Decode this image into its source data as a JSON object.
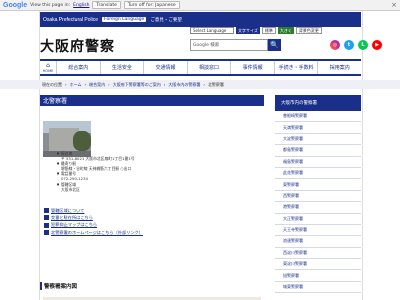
{
  "translate_bar": {
    "brand": "Google",
    "prompt": "View this page in:",
    "language": "English",
    "translate_btn": "Translate",
    "original_btn": "Turn off for: Japanese",
    "close": "×"
  },
  "topband": {
    "site_en": "Osaka Prefectural Police",
    "lang_btn": "Foreign Language",
    "links": "ご意見・ご要望"
  },
  "header": {
    "logo": "大阪府警察",
    "select_language": "Select Language",
    "font_small": "文字サイズ",
    "font_normal": "標準",
    "font_large": "大きく",
    "color_btn": "背景色変更",
    "search_placeholder": "Google 検索",
    "search_btn": "🔍",
    "social": [
      "instagram",
      "twitter",
      "line",
      "youtube"
    ]
  },
  "nav": {
    "home": "HOME",
    "items": [
      "総合案内",
      "生活安全",
      "交通情報",
      "相談窓口",
      "事件情報",
      "手続き・手数料",
      "採用案内"
    ]
  },
  "breadcrumb": [
    "現在の位置",
    "ホーム",
    "総合案内",
    "大阪府下警察署等のご案内",
    "大阪市内の警察署",
    "北警察署"
  ],
  "page": {
    "title": "北警察署",
    "info": {
      "addr_label": "所在地",
      "addr": "〒 531-8021 大阪市北区扇町1丁目1番1号",
      "access_label": "最寄り駅",
      "access": "堺筋線・谷町線 天神橋筋六丁目駅 ○出口",
      "tel_label": "電話番号",
      "tel": "072-290-1234",
      "area_label": "管轄区域",
      "area": "大阪市北区"
    },
    "links": [
      "管轄区域について",
      "交番と駐在所はこちら",
      "犯罪抑止マップはこちら",
      "北警察署のホームページはこちら（外部リンク）"
    ],
    "map_title": "警察署案内図"
  },
  "sidebar": {
    "heading": "大阪市内の警察署",
    "items": [
      "曽根崎警察署",
      "天満警察署",
      "大淀警察署",
      "都島警察署",
      "福島警察署",
      "此花警察署",
      "東警察署",
      "西警察署",
      "港警察署",
      "大正警察署",
      "天王寺警察署",
      "浪速警察署",
      "西淀川警察署",
      "東淀川警察署",
      "旭警察署",
      "城東警察署"
    ]
  },
  "colors": {
    "brand_blue": "#1a2f8a",
    "crumb_bg": "#eef0f5"
  }
}
